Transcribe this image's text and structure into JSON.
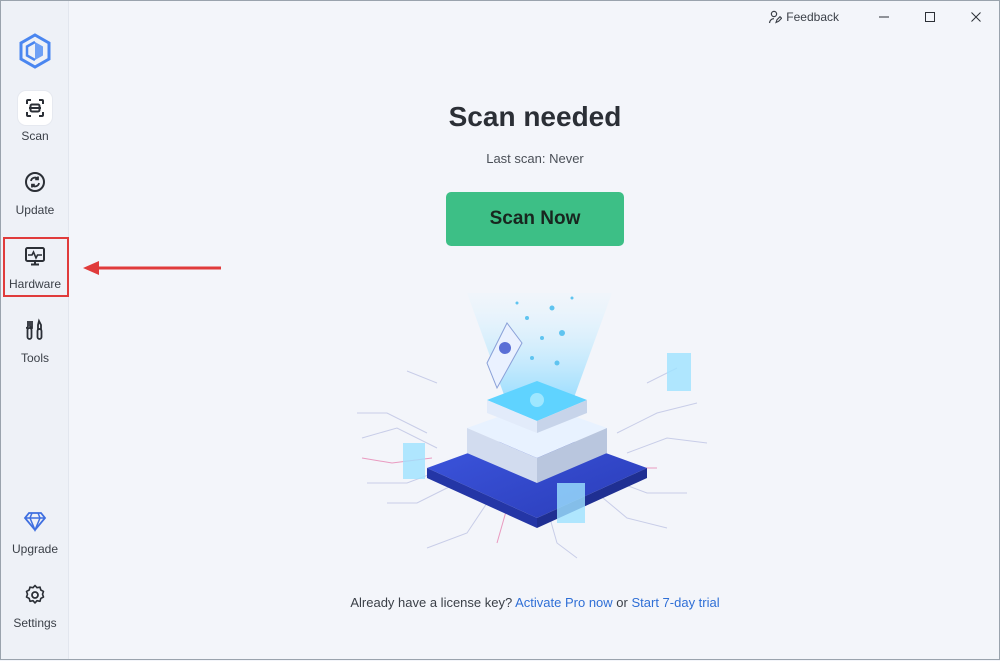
{
  "titlebar": {
    "feedback_label": "Feedback"
  },
  "sidebar": {
    "items": [
      {
        "label": "Scan",
        "icon": "scan-icon"
      },
      {
        "label": "Update",
        "icon": "update-icon"
      },
      {
        "label": "Hardware",
        "icon": "hardware-monitor-icon"
      },
      {
        "label": "Tools",
        "icon": "tools-icon"
      },
      {
        "label": "Upgrade",
        "icon": "diamond-icon"
      },
      {
        "label": "Settings",
        "icon": "gear-icon"
      }
    ]
  },
  "main": {
    "title": "Scan needed",
    "last_scan": "Last scan: Never",
    "scan_button": "Scan Now",
    "footer_text": "Already have a license key?",
    "activate_link": "Activate Pro now",
    "or_text": "or",
    "trial_link": "Start 7-day trial"
  },
  "colors": {
    "accent_green": "#3dbf86",
    "link_blue": "#2f6fd6",
    "highlight_red": "#e03b3b"
  }
}
